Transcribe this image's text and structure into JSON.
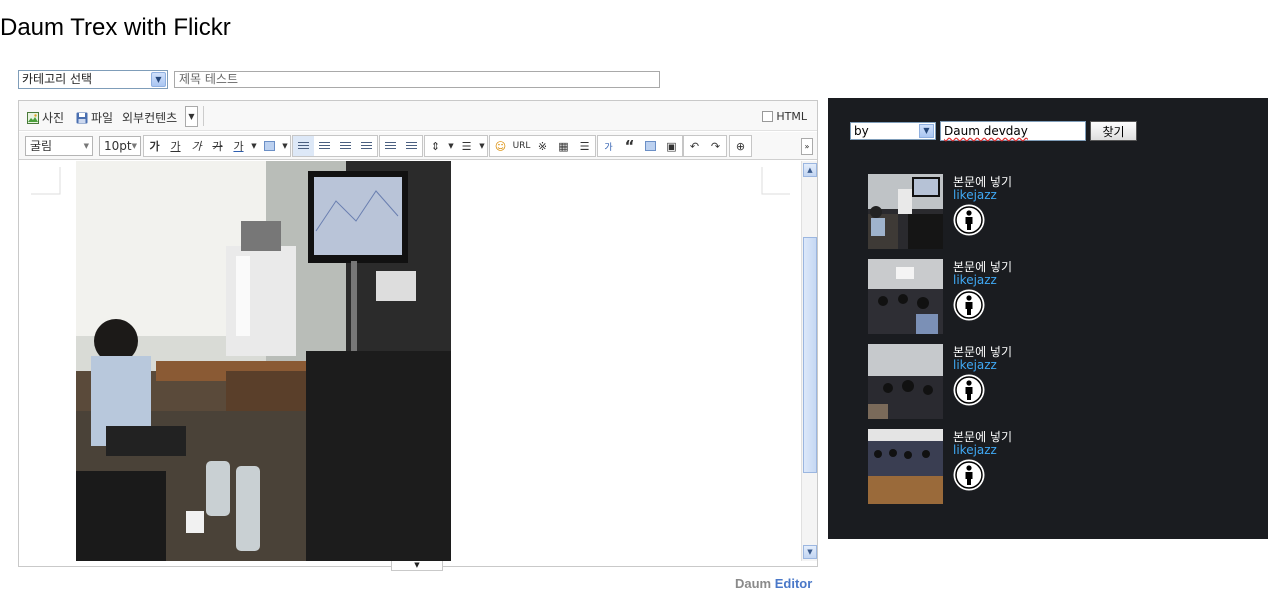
{
  "page": {
    "title": "Daum Trex with Flickr"
  },
  "post": {
    "category_select": "카테고리 선택",
    "title_value": "제목 테스트"
  },
  "editor": {
    "toolbar1": {
      "photo": "사진",
      "file": "파일",
      "external": "외부컨텐츠",
      "html": "HTML"
    },
    "toolbar2": {
      "font_family": "굴림",
      "font_size": "10pt",
      "bold": "가",
      "underline": "가",
      "italic": "가",
      "strike": "가",
      "font_color": "가",
      "url": "URL",
      "special_char": "※",
      "box": "가",
      "quote": "“"
    }
  },
  "brand": {
    "daum": "Daum",
    "editor": "Editor"
  },
  "flickr": {
    "search_by": "by",
    "search_query": "Daum devday",
    "search_button": "찾기",
    "results": [
      {
        "insert": "본문에 넣기",
        "author": "likejazz"
      },
      {
        "insert": "본문에 넣기",
        "author": "likejazz"
      },
      {
        "insert": "본문에 넣기",
        "author": "likejazz"
      },
      {
        "insert": "본문에 넣기",
        "author": "likejazz"
      }
    ]
  }
}
